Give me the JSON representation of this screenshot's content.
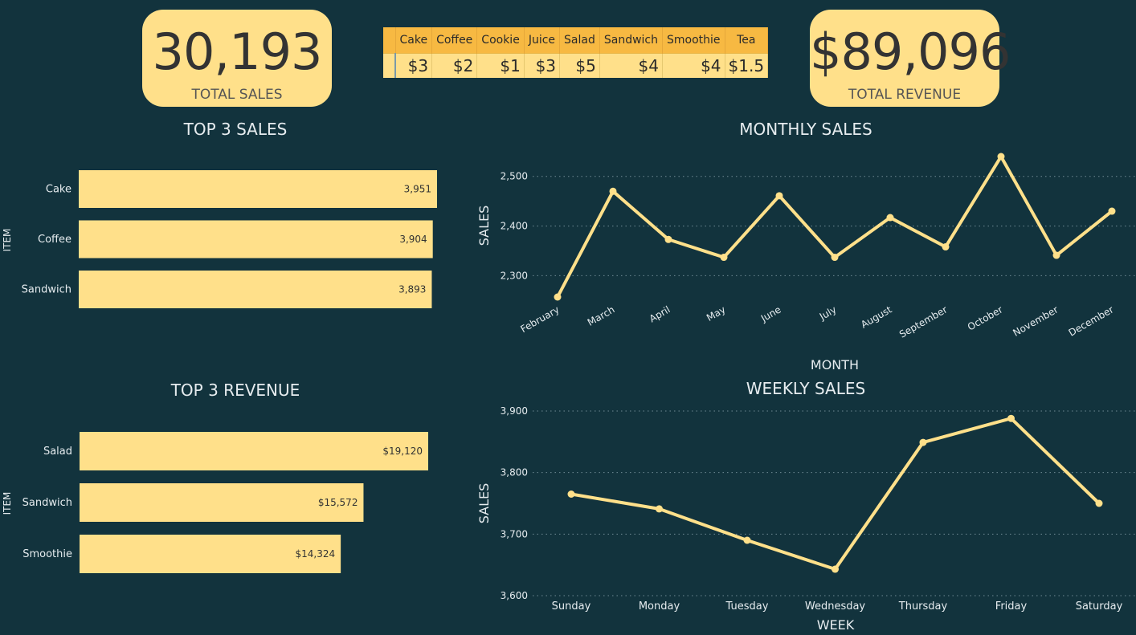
{
  "kpis": {
    "total_sales": {
      "value": "30,193",
      "label": "TOTAL SALES"
    },
    "total_revenue": {
      "value": "$89,096",
      "label": "TOTAL REVENUE"
    }
  },
  "price_table": {
    "headers": [
      "Cake",
      "Coffee",
      "Cookie",
      "Juice",
      "Salad",
      "Sandwich",
      "Smoothie",
      "Tea"
    ],
    "prices": [
      "$3",
      "$2",
      "$1",
      "$3",
      "$5",
      "$4",
      "$4",
      "$1.5"
    ]
  },
  "colors": {
    "background": "#12333d",
    "bar": "#ffe08a",
    "line": "#ffe08a",
    "table_header": "#f7b942"
  },
  "chart_data": [
    {
      "type": "bar",
      "orientation": "horizontal",
      "title": "TOP 3 SALES",
      "ylabel": "ITEM",
      "categories": [
        "Cake",
        "Coffee",
        "Sandwich"
      ],
      "values": [
        3951,
        3904,
        3893
      ],
      "data_labels": [
        "3,951",
        "3,904",
        "3,893"
      ]
    },
    {
      "type": "bar",
      "orientation": "horizontal",
      "title": "TOP 3 REVENUE",
      "ylabel": "ITEM",
      "categories": [
        "Salad",
        "Sandwich",
        "Smoothie"
      ],
      "values": [
        19120,
        15572,
        14324
      ],
      "data_labels": [
        "$19,120",
        "$15,572",
        "$14,324"
      ]
    },
    {
      "type": "line",
      "title": "MONTHLY SALES",
      "xlabel": "MONTH",
      "ylabel": "SALES",
      "categories": [
        "February",
        "March",
        "April",
        "May",
        "June",
        "July",
        "August",
        "September",
        "October",
        "November",
        "December"
      ],
      "values": [
        2257,
        2470,
        2373,
        2337,
        2461,
        2337,
        2417,
        2358,
        2540,
        2341,
        2430
      ],
      "ylim": [
        2257,
        2540
      ],
      "yticks": [
        2300,
        2400,
        2500
      ],
      "ytick_labels": [
        "2,300",
        "2,400",
        "2,500"
      ],
      "grid": true
    },
    {
      "type": "line",
      "title": "WEEKLY SALES",
      "xlabel": "WEEK",
      "ylabel": "SALES",
      "categories": [
        "Sunday",
        "Monday",
        "Tuesday",
        "Wednesday",
        "Thursday",
        "Friday",
        "Saturday"
      ],
      "values": [
        3765,
        3741,
        3690,
        3643,
        3849,
        3888,
        3750
      ],
      "ylim": [
        3600,
        3900
      ],
      "yticks": [
        3600,
        3700,
        3800,
        3900
      ],
      "ytick_labels": [
        "3,600",
        "3,700",
        "3,800",
        "3,900"
      ],
      "grid": true
    }
  ]
}
